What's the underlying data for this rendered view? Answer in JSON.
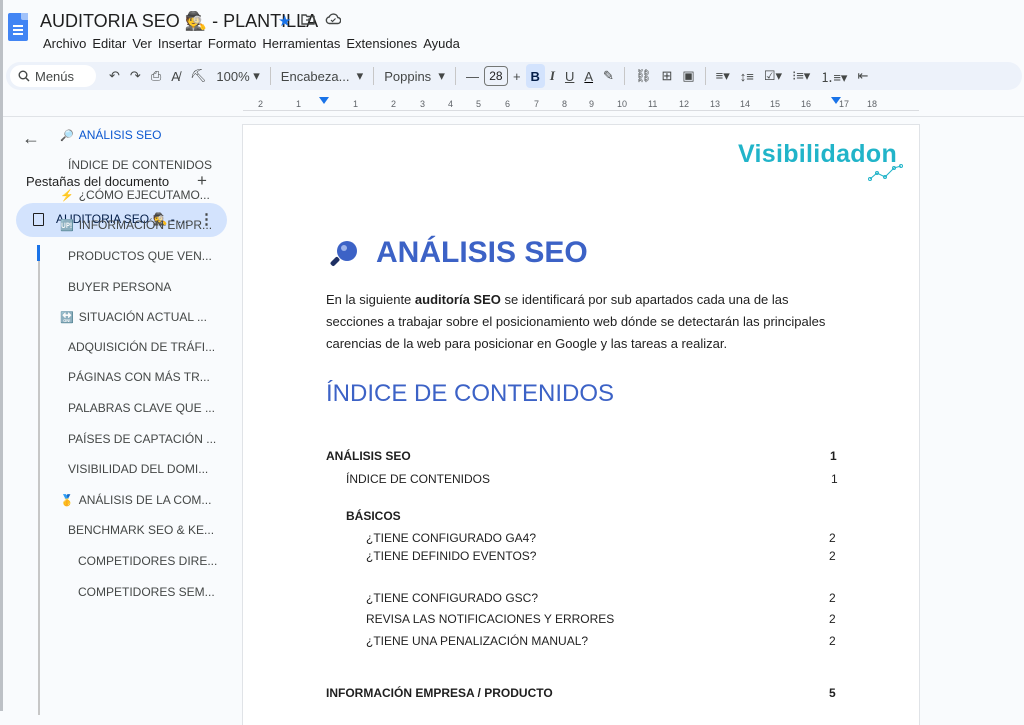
{
  "document": {
    "title": "AUDITORIA SEO 🕵️ - PLANTILLA"
  },
  "menu": [
    "Archivo",
    "Editar",
    "Ver",
    "Insertar",
    "Formato",
    "Herramientas",
    "Extensiones",
    "Ayuda"
  ],
  "toolbar": {
    "menus_search": "Menús",
    "zoom": "100%",
    "style": "Encabeza...",
    "font": "Poppins",
    "font_size": "28",
    "bold": "B",
    "italic": "I",
    "underline": "U",
    "text_color": "A"
  },
  "ruler": {
    "ticks": [
      "2",
      "1",
      "1",
      "2",
      "3",
      "4",
      "5",
      "6",
      "7",
      "8",
      "9",
      "10",
      "11",
      "12",
      "13",
      "14",
      "15",
      "16",
      "17",
      "18"
    ]
  },
  "sidebar": {
    "heading": "Pestañas del documento",
    "active_tab": "AUDITORIA SEO 🕵️ - ...",
    "outline": [
      {
        "icon": "🔎",
        "label": "ANÁLISIS SEO",
        "selected": true
      },
      {
        "icon": "",
        "label": "ÍNDICE DE CONTENIDOS"
      },
      {
        "icon": "⚡",
        "label": "¿CÓMO EJECUTAMO..."
      },
      {
        "icon": "🆙",
        "label": "INFORMACIÓN EMPR..."
      },
      {
        "icon": "",
        "label": "PRODUCTOS QUE VEN..."
      },
      {
        "icon": "",
        "label": "BUYER PERSONA"
      },
      {
        "icon": "🔛",
        "label": "SITUACIÓN ACTUAL ..."
      },
      {
        "icon": "",
        "label": "ADQUISICIÓN DE TRÁFI..."
      },
      {
        "icon": "",
        "label": "PÁGINAS CON MÁS TR..."
      },
      {
        "icon": "",
        "label": "PALABRAS CLAVE QUE ..."
      },
      {
        "icon": "",
        "label": "PAÍSES DE CAPTACIÓN ..."
      },
      {
        "icon": "",
        "label": "VISIBILIDAD DEL DOMI..."
      },
      {
        "icon": "🥇",
        "label": "ANÁLISIS DE LA COM..."
      },
      {
        "icon": "",
        "label": "BENCHMARK SEO & KE..."
      },
      {
        "icon": "",
        "label": "COMPETIDORES DIRE..."
      },
      {
        "icon": "",
        "label": "COMPETIDORES SEM..."
      }
    ]
  },
  "page": {
    "logo": "Visibilidadon",
    "heading": "ANÁLISIS SEO",
    "intro_before": "En la siguiente ",
    "intro_bold": "auditoría SEO",
    "intro_after": " se identificará por sub apartados cada una de las secciones a trabajar sobre el posicionamiento web dónde se detectarán las principales carencias de la web para posicionar en Google y las tareas a realizar.",
    "toc_heading": "ÍNDICE DE CONTENIDOS",
    "toc": [
      {
        "label": "ANÁLISIS SEO",
        "page": "1"
      },
      {
        "label": "ÍNDICE DE CONTENIDOS",
        "page": "1"
      },
      {
        "label": "BÁSICOS",
        "page": ""
      },
      {
        "label": "¿TIENE CONFIGURADO GA4?",
        "page": "2"
      },
      {
        "label": "¿TIENE DEFINIDO EVENTOS?",
        "page": "2"
      },
      {
        "label": "¿TIENE CONFIGURADO GSC?",
        "page": "2"
      },
      {
        "label": "REVISA LAS NOTIFICACIONES Y ERRORES",
        "page": "2"
      },
      {
        "label": "¿TIENE UNA PENALIZACIÓN MANUAL?",
        "page": "2"
      },
      {
        "label": "INFORMACIÓN EMPRESA / PRODUCTO",
        "page": "5"
      }
    ]
  }
}
